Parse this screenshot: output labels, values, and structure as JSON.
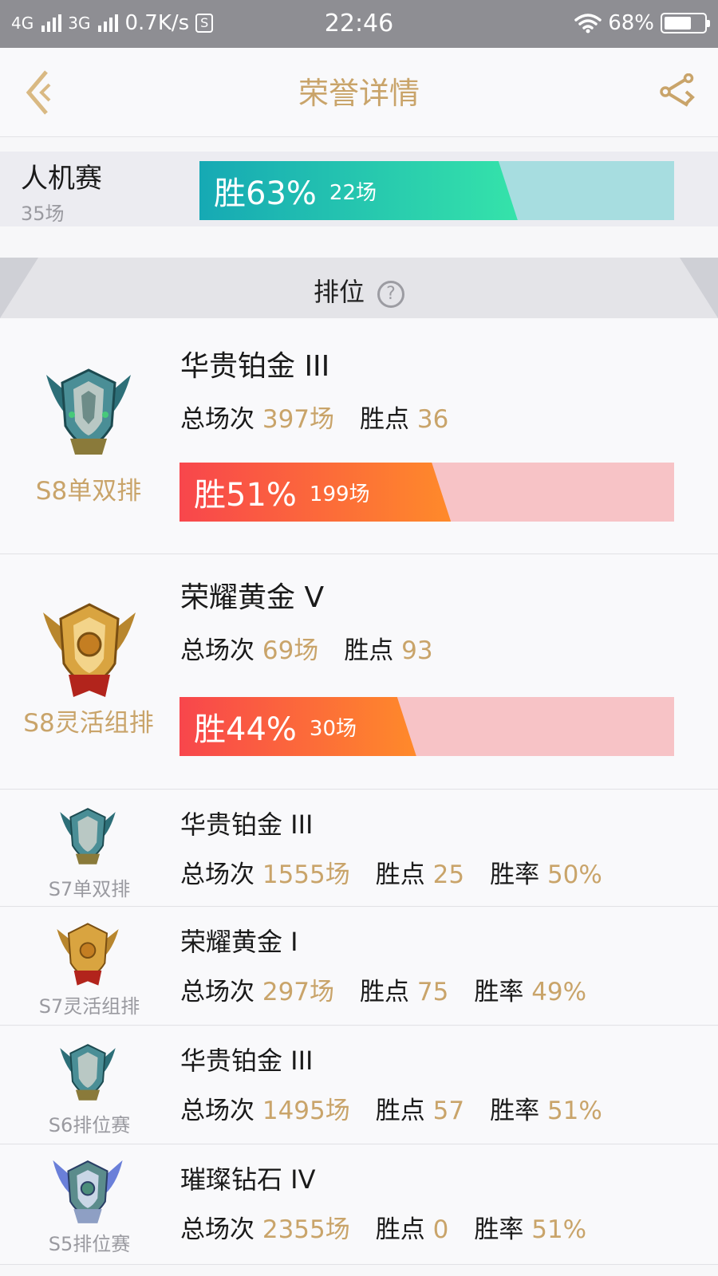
{
  "status_bar": {
    "net1": "4G",
    "net2": "3G",
    "speed": "0.7K/s",
    "sim_icon": "S",
    "time": "22:46",
    "battery": "68%",
    "battery_level": 0.68
  },
  "header": {
    "title": "荣誉详情",
    "back_icon": "back-arrow-icon",
    "share_icon": "share-icon"
  },
  "pve": {
    "name": "人机赛",
    "count": "35场",
    "win_pct": "胜63%",
    "win_games": "22场",
    "win_rate": 0.63
  },
  "section": {
    "label": "排位",
    "help_glyph": "?"
  },
  "ranked_big": [
    {
      "season": "S8单双排",
      "rank": "华贵铂金 III",
      "total_label": "总场次",
      "total": "397场",
      "points_label": "胜点",
      "points": "36",
      "win_pct": "胜51%",
      "win_games": "199场",
      "win_rate": 0.51,
      "emblem": "platinum-emblem-icon"
    },
    {
      "season": "S8灵活组排",
      "rank": "荣耀黄金 V",
      "total_label": "总场次",
      "total": "69场",
      "points_label": "胜点",
      "points": "93",
      "win_pct": "胜44%",
      "win_games": "30场",
      "win_rate": 0.44,
      "emblem": "gold-emblem-icon"
    }
  ],
  "ranked_small": [
    {
      "season": "S7单双排",
      "rank": "华贵铂金 III",
      "total_label": "总场次",
      "total": "1555场",
      "points_label": "胜点",
      "points": "25",
      "rate_label": "胜率",
      "rate": "50%",
      "emblem": "platinum-emblem-icon"
    },
    {
      "season": "S7灵活组排",
      "rank": "荣耀黄金 I",
      "total_label": "总场次",
      "total": "297场",
      "points_label": "胜点",
      "points": "75",
      "rate_label": "胜率",
      "rate": "49%",
      "emblem": "gold-emblem-icon"
    },
    {
      "season": "S6排位赛",
      "rank": "华贵铂金 III",
      "total_label": "总场次",
      "total": "1495场",
      "points_label": "胜点",
      "points": "57",
      "rate_label": "胜率",
      "rate": "51%",
      "emblem": "platinum-emblem-icon"
    },
    {
      "season": "S5排位赛",
      "rank": "璀璨钻石 IV",
      "total_label": "总场次",
      "total": "2355场",
      "points_label": "胜点",
      "points": "0",
      "rate_label": "胜率",
      "rate": "51%",
      "emblem": "diamond-emblem-icon"
    }
  ],
  "colors": {
    "accent_gold": "#c9a46a",
    "teal_start": "#16a9b4",
    "teal_end": "#35e3aa",
    "red_start": "#f8464c",
    "red_end": "#ff8a2a"
  }
}
